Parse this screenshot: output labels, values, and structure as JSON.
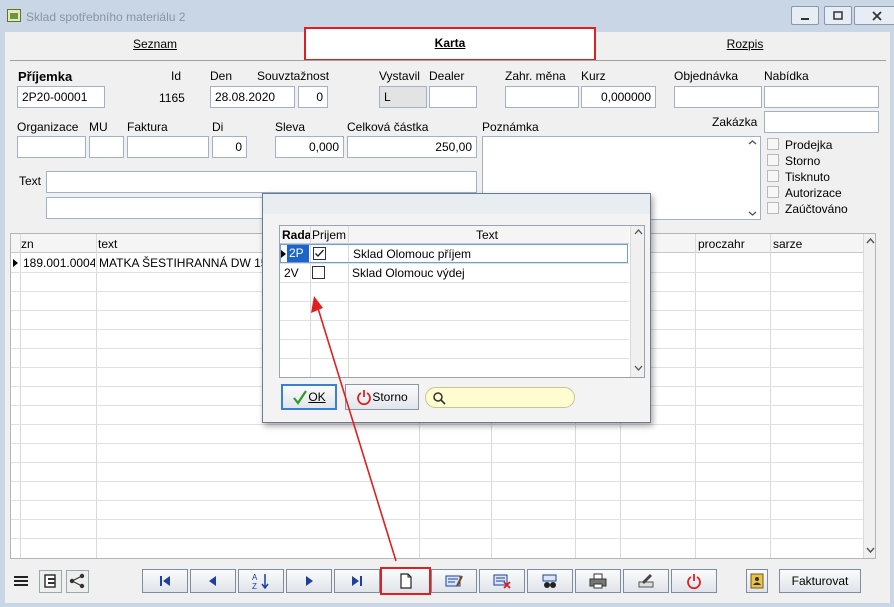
{
  "window": {
    "title": "Sklad spotřebního materiálu 2"
  },
  "tabs": [
    {
      "label": "Seznam"
    },
    {
      "label": "Karta"
    },
    {
      "label": "Rozpis"
    }
  ],
  "form": {
    "prijemka_label": "Příjemka",
    "prijemka_value": "2P20-00001",
    "id_label": "Id",
    "id_value": "1165",
    "den_label": "Den",
    "den_value": "28.08.2020",
    "souvztaznost_label": "Souvztažnost",
    "souvztaznost_value": "0",
    "vystavil_label": "Vystavil",
    "vystavil_value": "L",
    "dealer_label": "Dealer",
    "dealer_value": "",
    "zahr_mena_label": "Zahr. měna",
    "zahr_mena_value": "",
    "kurz_label": "Kurz",
    "kurz_value": "0,000000",
    "objednavka_label": "Objednávka",
    "objednavka_value": "",
    "nabidka_label": "Nabídka",
    "nabidka_value": "",
    "zakazka_label": "Zakázka",
    "zakazka_value": "",
    "organizace_label": "Organizace",
    "organizace_value": "",
    "mu_label": "MU",
    "mu_value": "",
    "faktura_label": "Faktura",
    "faktura_value": "",
    "di_label": "Di",
    "di_value": "0",
    "sleva_label": "Sleva",
    "sleva_value": "0,000",
    "celkova_label": "Celková částka",
    "celkova_value": "250,00",
    "poznamka_label": "Poznámka",
    "poznamka_value": "",
    "text_label": "Text",
    "text_value": "",
    "text2_value": ""
  },
  "flags": [
    {
      "label": "Prodejka",
      "checked": false
    },
    {
      "label": "Storno",
      "checked": false
    },
    {
      "label": "Tisknuto",
      "checked": false
    },
    {
      "label": "Autorizace",
      "checked": false
    },
    {
      "label": "Zaúčtováno",
      "checked": false
    }
  ],
  "grid": {
    "columns": [
      "zn",
      "text",
      "proczahr",
      "sarze"
    ],
    "rows": [
      {
        "zn": "189.001.0004",
        "text": "MATKA ŠESTIHRANNÁ DW 15"
      }
    ]
  },
  "dialog": {
    "columns": [
      "Rada",
      "Prijem",
      "Text"
    ],
    "rows": [
      {
        "rada": "2P",
        "prijem": true,
        "text": "Sklad Olomouc příjem"
      },
      {
        "rada": "2V",
        "prijem": false,
        "text": "Sklad Olomouc výdej"
      }
    ],
    "ok_label": "OK",
    "storno_label": "Storno",
    "search_placeholder": ""
  },
  "toolbar": {
    "fakturovat_label": "Fakturovat"
  },
  "colors": {
    "highlight": "#e02020",
    "selection": "#1e64c8"
  }
}
